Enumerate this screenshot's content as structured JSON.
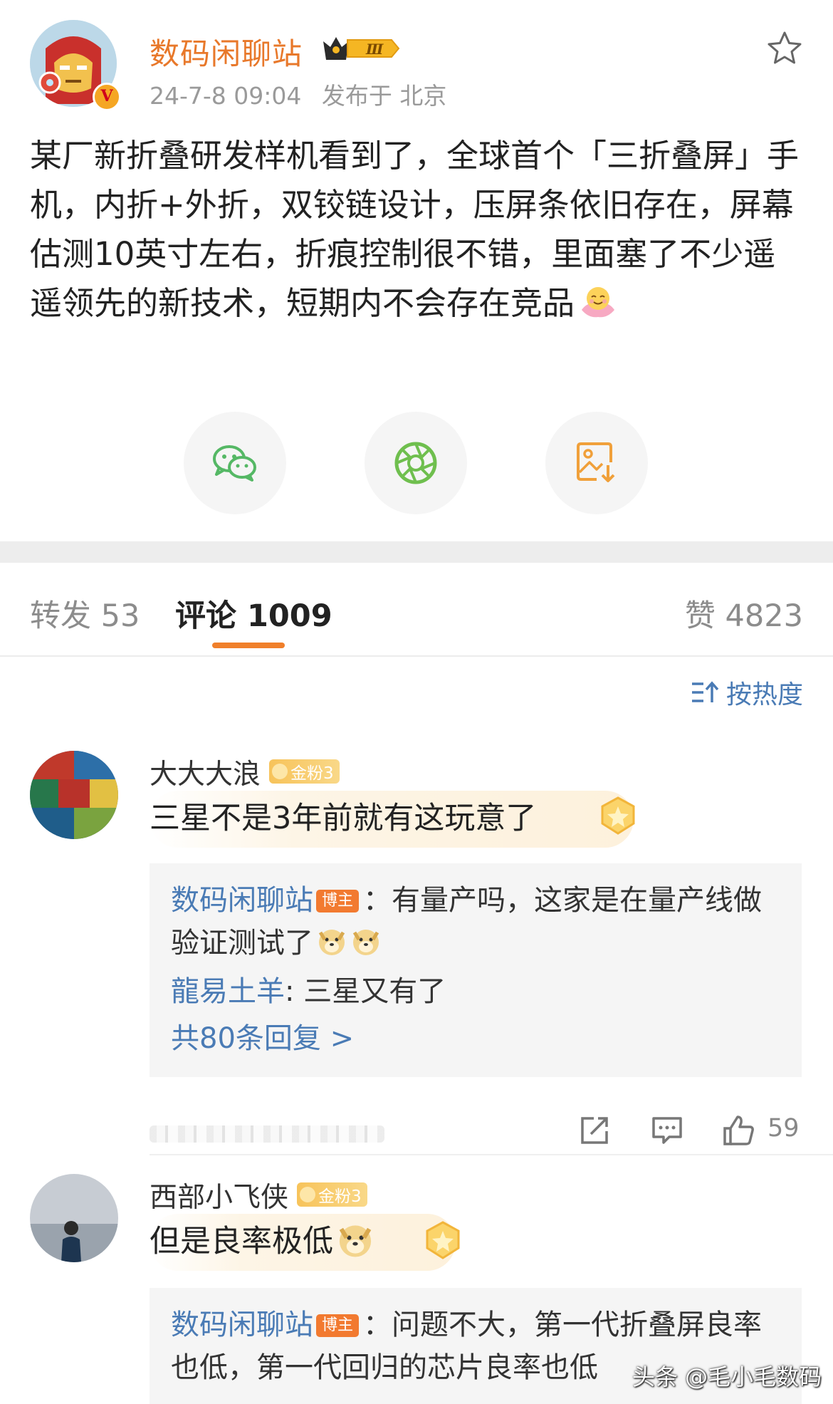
{
  "post": {
    "author": "数码闲聊站",
    "verified_mark": "V",
    "vip_level": "Ⅲ",
    "date": "24-7-8 09:04",
    "location": "发布于 北京",
    "content": "某厂新折叠研发样机看到了，全球首个「三折叠屏」手机，内折+外折，双铰链设计，压屏条依旧存在，屏幕估测10英寸左右，折痕控制很不错，里面塞了不少遥遥领先的新技术，短期内不会存在竞品"
  },
  "share_buttons": [
    {
      "icon": "wechat-icon",
      "color": "#55b865"
    },
    {
      "icon": "moments-icon",
      "color": "#6fbf4e"
    },
    {
      "icon": "save-image-icon",
      "color": "#f0a03a"
    }
  ],
  "tabs": {
    "repost": "转发 53",
    "comments": "评论 1009",
    "likes": "赞 4823"
  },
  "sort_label": "按热度",
  "comments": [
    {
      "user": "大大大浪",
      "badge": "金粉3",
      "text": "三星不是3年前就有这玩意了",
      "replies": [
        {
          "user": "数码闲聊站",
          "tag": "博主",
          "text": "：有量产吗，这家是在量产线做验证测试了"
        },
        {
          "user": "龍易土羊",
          "text": ": 三星又有了"
        }
      ],
      "more_replies": "共80条回复 >",
      "like_count": "59"
    },
    {
      "user": "西部小飞侠",
      "badge": "金粉3",
      "text": "但是良率极低",
      "replies": [
        {
          "user": "数码闲聊站",
          "tag": "博主",
          "text": "：问题不大，第一代折叠屏良率也低，第一代回归的芯片良率也低"
        }
      ]
    }
  ],
  "watermark": "头条 @毛小毛数码",
  "colors": {
    "author": "#e8782a",
    "link": "#4a7bb5",
    "accent": "#f07f2a",
    "blogger_tag": "#f27a30"
  }
}
